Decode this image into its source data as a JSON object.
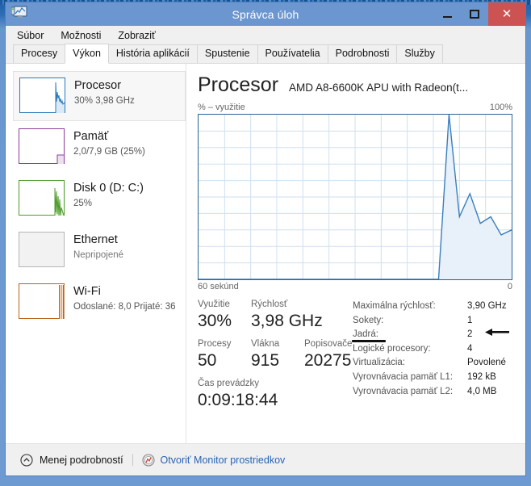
{
  "window": {
    "title": "Správca úloh",
    "app_icon": "task-manager-icon",
    "controls": {
      "minimize": "–",
      "maximize": "□",
      "close": "✕"
    }
  },
  "menu": {
    "items": [
      "Súbor",
      "Možnosti",
      "Zobraziť"
    ]
  },
  "tabs": {
    "items": [
      "Procesy",
      "Výkon",
      "História aplikácií",
      "Spustenie",
      "Používatelia",
      "Podrobnosti",
      "Služby"
    ],
    "active": "Výkon"
  },
  "sidebar": {
    "items": [
      {
        "title": "Procesor",
        "sub": "30%  3,98 GHz",
        "color": "#2a7ab9",
        "selected": true
      },
      {
        "title": "Pamäť",
        "sub": "2,0/7,9 GB (25%)",
        "color": "#8b3f98",
        "selected": false
      },
      {
        "title": "Disk 0 (D: C:)",
        "sub": "25%",
        "color": "#4c9a2a",
        "selected": false
      },
      {
        "title": "Ethernet",
        "sub": "Nepripojené",
        "color": "#b0b0b0",
        "selected": false
      },
      {
        "title": "Wi-Fi",
        "sub": "Odoslané: 8,0 Prijaté: 36",
        "color": "#b5651d",
        "selected": false
      }
    ]
  },
  "detail": {
    "title": "Procesor",
    "subtitle": "AMD A8-6600K APU with Radeon(t...",
    "graph_top_label": "% – využitie",
    "graph_top_right": "100%",
    "graph_foot_left": "60 sekúnd",
    "graph_foot_right": "0",
    "stats": {
      "utilization_label": "Využitie",
      "utilization_value": "30%",
      "speed_label": "Rýchlosť",
      "speed_value": "3,98 GHz",
      "processes_label": "Procesy",
      "processes_value": "50",
      "threads_label": "Vlákna",
      "threads_value": "915",
      "handles_label": "Popisovače",
      "handles_value": "20275",
      "uptime_label": "Čas prevádzky",
      "uptime_value": "0:09:18:44"
    },
    "specs": [
      {
        "key": "Maximálna rýchlosť:",
        "value": "3,90 GHz",
        "annotated": false
      },
      {
        "key": "Sokety:",
        "value": "1",
        "annotated": false
      },
      {
        "key": "Jadrá:",
        "value": "2",
        "annotated": true
      },
      {
        "key": "Logické procesory:",
        "value": "4",
        "annotated": false
      },
      {
        "key": "Virtualizácia:",
        "value": "Povolené",
        "annotated": false
      },
      {
        "key": "Vyrovnávacia pamäť L1:",
        "value": "192 kB",
        "annotated": false
      },
      {
        "key": "Vyrovnávacia pamäť L2:",
        "value": "4,0 MB",
        "annotated": false
      }
    ]
  },
  "footer": {
    "collapse_label": "Menej podrobností",
    "collapse_icon": "chevron-up-circle-icon",
    "link_label": "Otvoriť Monitor prostriedkov",
    "link_icon": "resource-monitor-icon"
  },
  "chart_data": {
    "type": "area",
    "title": "% – využitie",
    "xlabel": "60 sekúnd",
    "ylabel": "% – využitie",
    "ylim": [
      0,
      100
    ],
    "xlim": [
      0,
      60
    ],
    "grid": true,
    "legend": "none",
    "line_color": "#3a7ebf",
    "fill_color": "#e8f1f9",
    "x": [
      0,
      2,
      4,
      6,
      8,
      10,
      12,
      14,
      16,
      18,
      20,
      22,
      24,
      26,
      28,
      30,
      32,
      34,
      36,
      38,
      40,
      42,
      44,
      46,
      48,
      50,
      52,
      54,
      56,
      58,
      60
    ],
    "values": [
      0,
      0,
      0,
      0,
      0,
      0,
      0,
      0,
      0,
      0,
      0,
      0,
      0,
      0,
      0,
      0,
      0,
      0,
      0,
      0,
      0,
      0,
      0,
      0,
      100,
      38,
      52,
      34,
      38,
      27,
      30
    ]
  }
}
